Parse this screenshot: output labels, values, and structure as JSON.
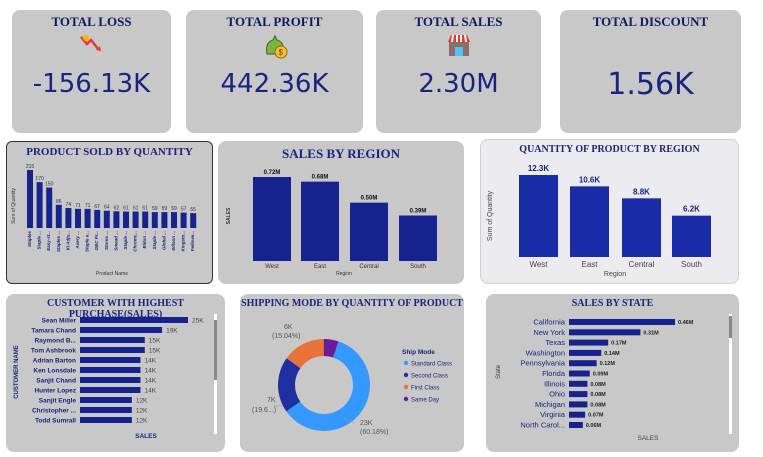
{
  "kpis": [
    {
      "title": "TOTAL LOSS",
      "value": "-156.13K",
      "icon": "loss-chart-icon"
    },
    {
      "title": "TOTAL PROFIT",
      "value": "442.36K",
      "icon": "money-bag-icon"
    },
    {
      "title": "TOTAL SALES",
      "value": "2.30M",
      "icon": "store-icon"
    },
    {
      "title": "TOTAL DISCOUNT",
      "value": "1.56K",
      "icon": ""
    }
  ],
  "colors": {
    "bar": "#16238f",
    "card": "#c8c8c8",
    "standard": "#3399ff",
    "second": "#1f2fa0",
    "first": "#e8723a",
    "sameday": "#6a1b9a"
  },
  "chart_data": [
    {
      "type": "bar",
      "title": "PRODUCT SOLD BY QUANTITY",
      "xlabel": "Product Name",
      "ylabel": "Sum of Quantity",
      "categories": [
        "Staples",
        "Staple ...",
        "Easy-st...",
        "Staples ...",
        "KI Adju...",
        "Avery ...",
        "Staple e...",
        "GBC Pr...",
        "Storex ...",
        "Smead ...",
        "Staple ...",
        "Chromc...",
        "Eldon ...",
        "Staple ...",
        "Global ...",
        "Wilson ...",
        "Kingsto...",
        "Fellowe..."
      ],
      "values": [
        215,
        170,
        150,
        86,
        74,
        71,
        71,
        67,
        64,
        62,
        61,
        61,
        61,
        59,
        59,
        59,
        57,
        55
      ]
    },
    {
      "type": "bar",
      "title": "SALES BY REGION",
      "xlabel": "Region",
      "ylabel": "SALES",
      "categories": [
        "West",
        "East",
        "Central",
        "South"
      ],
      "values": [
        0.72,
        0.68,
        0.5,
        0.39
      ],
      "labels": [
        "0.72M",
        "0.68M",
        "0.50M",
        "0.39M"
      ]
    },
    {
      "type": "bar",
      "title": "QUANTITY OF PRODUCT BY REGION",
      "xlabel": "Region",
      "ylabel": "Sum of Quantity",
      "categories": [
        "West",
        "East",
        "Central",
        "South"
      ],
      "values": [
        12.3,
        10.6,
        8.8,
        6.2
      ],
      "labels": [
        "12.3K",
        "10.6K",
        "8.8K",
        "6.2K"
      ]
    },
    {
      "type": "bar",
      "orientation": "horizontal",
      "title": "CUSTOMER WITH HIGHEST PURCHASE(SALES)",
      "xlabel": "SALES",
      "ylabel": "CUSTOMER NAME",
      "categories": [
        "Sean Miller",
        "Tamara Chand",
        "Raymond B...",
        "Tom Ashbrook",
        "Adrian Barton",
        "Ken Lonsdale",
        "Sanjit Chand",
        "Hunter Lopez",
        "Sanjit Engle",
        "Christopher ...",
        "Todd Sumrall"
      ],
      "values": [
        25,
        19,
        15,
        15,
        14,
        14,
        14,
        14,
        12,
        12,
        12
      ],
      "labels": [
        "25K",
        "19K",
        "15K",
        "15K",
        "14K",
        "14K",
        "14K",
        "14K",
        "12K",
        "12K",
        "12K"
      ]
    },
    {
      "type": "pie",
      "title": "SHIPPING MODE BY QUANTITY OF PRODUCT",
      "legend_title": "Ship Mode",
      "series": [
        {
          "name": "Standard Class",
          "value": 60.18,
          "label1": "23K",
          "label2": "(60.18%)"
        },
        {
          "name": "Second Class",
          "value": 19.6,
          "label1": "7K",
          "label2": "(19.6...)"
        },
        {
          "name": "First Class",
          "value": 15.04,
          "label1": "6K",
          "label2": "(15.04%)"
        },
        {
          "name": "Same Day",
          "value": 5.18,
          "label1": "",
          "label2": ""
        }
      ]
    },
    {
      "type": "bar",
      "orientation": "horizontal",
      "title": "SALES BY STATE",
      "xlabel": "SALES",
      "ylabel": "State",
      "categories": [
        "California",
        "New York",
        "Texas",
        "Washington",
        "Pennsylvania",
        "Florida",
        "Illinois",
        "Ohio",
        "Michigan",
        "Virginia",
        "North Carol..."
      ],
      "values": [
        0.46,
        0.31,
        0.17,
        0.14,
        0.12,
        0.09,
        0.08,
        0.08,
        0.08,
        0.07,
        0.06
      ],
      "labels": [
        "0.46M",
        "0.31M",
        "0.17M",
        "0.14M",
        "0.12M",
        "0.09M",
        "0.08M",
        "0.08M",
        "0.08M",
        "0.07M",
        "0.06M"
      ]
    }
  ]
}
